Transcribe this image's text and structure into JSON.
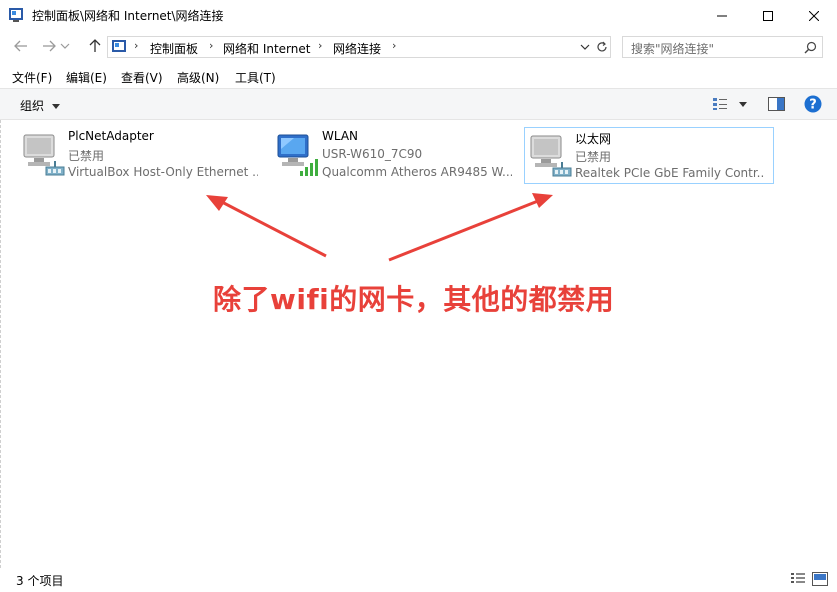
{
  "window": {
    "title": "控制面板\\网络和 Internet\\网络连接",
    "controls": [
      "minimize",
      "maximize",
      "close"
    ]
  },
  "address": {
    "breadcrumb": [
      "控制面板",
      "网络和 Internet",
      "网络连接"
    ],
    "search_placeholder": "搜索\"网络连接\""
  },
  "menu": [
    "文件(F)",
    "编辑(E)",
    "查看(V)",
    "高级(N)",
    "工具(T)"
  ],
  "toolbar": {
    "organize_label": "组织"
  },
  "adapters": [
    {
      "name": "PlcNetAdapter",
      "status": "已禁用",
      "device": "VirtualBox Host-Only Ethernet ...",
      "icon": "ethernet-adapter-disabled-icon"
    },
    {
      "name": "WLAN",
      "status": "USR-W610_7C90",
      "device": "Qualcomm Atheros AR9485 W...",
      "icon": "wifi-adapter-icon"
    },
    {
      "name": "以太网",
      "status": "已禁用",
      "device": "Realtek PCIe GbE Family Contr...",
      "icon": "ethernet-adapter-disabled-icon"
    }
  ],
  "annotation": {
    "text": "除了wifi的网卡，其他的都禁用",
    "color": "#e8413a"
  },
  "statusbar": {
    "item_count": "3 个项目"
  },
  "colors": {
    "selection_border": "#99d1ff",
    "help_blue": "#1c6fd1",
    "toolbar_bg": "#f5f6f7"
  }
}
